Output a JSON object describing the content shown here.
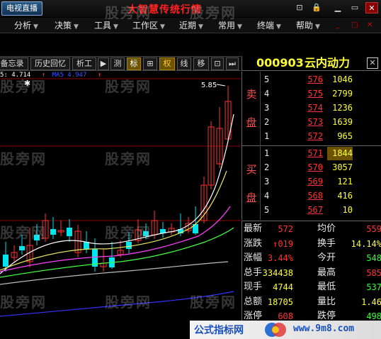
{
  "title": {
    "tv_button": "电视直播",
    "window_title": "大智慧传统行情"
  },
  "menu": [
    {
      "label": "分析"
    },
    {
      "label": "决策"
    },
    {
      "label": "工具"
    },
    {
      "label": "工作区"
    },
    {
      "label": "近期"
    },
    {
      "label": "常用"
    },
    {
      "label": "终端"
    },
    {
      "label": "帮助"
    }
  ],
  "toolbar": {
    "memo": "备忘录",
    "history": "历史回忆",
    "analyst": "析工",
    "measure": "测",
    "mark": "标",
    "cross": "⊞",
    "rights": "权",
    "line": "线",
    "move": "移"
  },
  "chart": {
    "ma_label_1": "5: 4.714",
    "ma_label_2": "MA5  4.947",
    "peak_label": "5.85"
  },
  "stock": {
    "code": "000903",
    "name": "云内动力"
  },
  "orderbook": {
    "sell_label_1": "卖",
    "sell_label_2": "盘",
    "buy_label_1": "买",
    "buy_label_2": "盘",
    "sell": [
      {
        "level": "5",
        "price": "576",
        "volume": "1046"
      },
      {
        "level": "4",
        "price": "575",
        "volume": "2799"
      },
      {
        "level": "3",
        "price": "574",
        "volume": "1236"
      },
      {
        "level": "2",
        "price": "573",
        "volume": "1639"
      },
      {
        "level": "1",
        "price": "572",
        "volume": "965"
      }
    ],
    "buy": [
      {
        "level": "1",
        "price": "571",
        "volume": "1844"
      },
      {
        "level": "2",
        "price": "570",
        "volume": "3057"
      },
      {
        "level": "3",
        "price": "569",
        "volume": "121"
      },
      {
        "level": "4",
        "price": "568",
        "volume": "416"
      },
      {
        "level": "5",
        "price": "567",
        "volume": "10"
      }
    ]
  },
  "stats": [
    {
      "l1": "最新",
      "v1": "572",
      "c1": "red",
      "l2": "均价",
      "v2": "559",
      "c2": "red"
    },
    {
      "l1": "涨跌",
      "v1": "↑019",
      "c1": "red",
      "l2": "换手",
      "v2": "14.14%",
      "c2": "yellow"
    },
    {
      "l1": "涨幅",
      "v1": "3.44%",
      "c1": "red",
      "l2": "今开",
      "v2": "548",
      "c2": "green"
    },
    {
      "l1": "总手",
      "v1": "334438",
      "c1": "yellow",
      "l2": "最高",
      "v2": "585",
      "c2": "red"
    },
    {
      "l1": "现手",
      "v1": "4744",
      "c1": "yellow",
      "l2": "最低",
      "v2": "537",
      "c2": "green"
    },
    {
      "l1": "总额",
      "v1": "18705",
      "c1": "yellow",
      "l2": "量比",
      "v2": "1.46",
      "c2": "yellow"
    },
    {
      "l1": "涨停",
      "v1": "608",
      "c1": "red",
      "l2": "跌停",
      "v2": "498",
      "c2": "green"
    }
  ],
  "watermark": "股旁网",
  "footer": {
    "title": "公式指标网",
    "url": "www.9m8.com"
  },
  "colors": {
    "up": "#ff3333",
    "down": "#00e5ee",
    "ma_white": "#ffffff",
    "ma_yellow": "#e8e860",
    "ma_magenta": "#ff40ff",
    "ma_green": "#40ff40",
    "ma_gray": "#bbbbbb",
    "ma_blue": "#3333ff"
  }
}
